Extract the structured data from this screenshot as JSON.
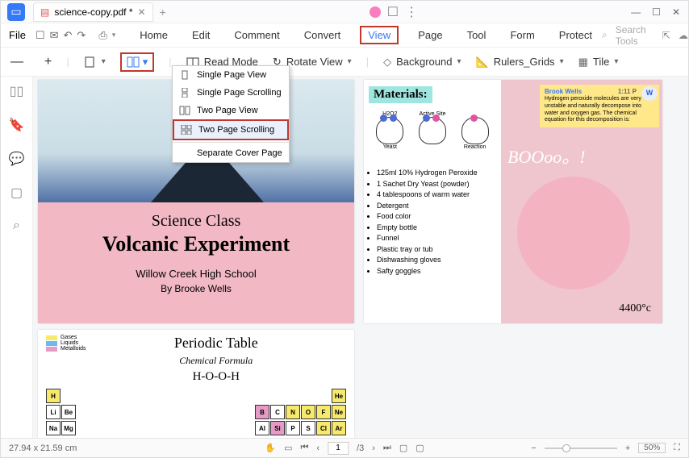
{
  "titlebar": {
    "filename": "science-copy.pdf *",
    "window": {
      "min": "—",
      "max": "☐",
      "close": "✕"
    }
  },
  "menubar": {
    "file": "File",
    "tabs": [
      "Home",
      "Edit",
      "Comment",
      "Convert",
      "View",
      "Page",
      "Tool",
      "Form",
      "Protect"
    ],
    "active_index": 4,
    "search_placeholder": "Search Tools"
  },
  "toolbar": {
    "minus": "—",
    "plus": "+",
    "read_mode": "Read Mode",
    "rotate": "Rotate View",
    "background": "Background",
    "rulers": "Rulers_Grids",
    "tile": "Tile"
  },
  "dropdown": {
    "items": [
      {
        "label": "Single Page View"
      },
      {
        "label": "Single Page Scrolling"
      },
      {
        "label": "Two Page View"
      },
      {
        "label": "Two Page Scrolling"
      },
      {
        "label": "Separate Cover Page"
      }
    ],
    "selected_index": 3
  },
  "page1": {
    "t1": "Science Class",
    "t2": "Volcanic Experiment",
    "t3": "Willow Creek High School",
    "t4": "By Brooke Wells"
  },
  "page2": {
    "heading": "Materials:",
    "diag": {
      "a": "H2O2",
      "b": "Active Site",
      "c": "Yeast",
      "d": "Reaction"
    },
    "items": [
      "125ml 10% Hydrogen Peroxide",
      "1 Sachet Dry Yeast (powder)",
      "4 tablespoons of warm water",
      "Detergent",
      "Food color",
      "Empty bottle",
      "Funnel",
      "Plastic tray or tub",
      "Dishwashing gloves",
      "Safty goggles"
    ],
    "note_author": "Brook Wells",
    "note_time": "1:11 P",
    "note_text": "Hydrogen peroxide molecules are very unstable and naturally decompose into water and oxygen gas. The chemical equation for this decomposition is:",
    "boo": "BOOoo。!",
    "temp": "4400°c"
  },
  "page3": {
    "legend": [
      "Gases",
      "Liquids",
      "Metalloids"
    ],
    "title": "Periodic Table",
    "sub": "Chemical Formula",
    "formula": "H-O-O-H",
    "row1": [
      "H"
    ],
    "row1r": [
      "He"
    ],
    "row2": [
      "Li",
      "Be"
    ],
    "row2r": [
      "B",
      "C",
      "N",
      "O",
      "F",
      "Ne"
    ],
    "row3r": [
      "Al",
      "Si",
      "P",
      "S",
      "Cl",
      "Ar"
    ]
  },
  "statusbar": {
    "dims": "27.94 x 21.59 cm",
    "page": "1",
    "total": "/3",
    "zoom": "50%"
  }
}
